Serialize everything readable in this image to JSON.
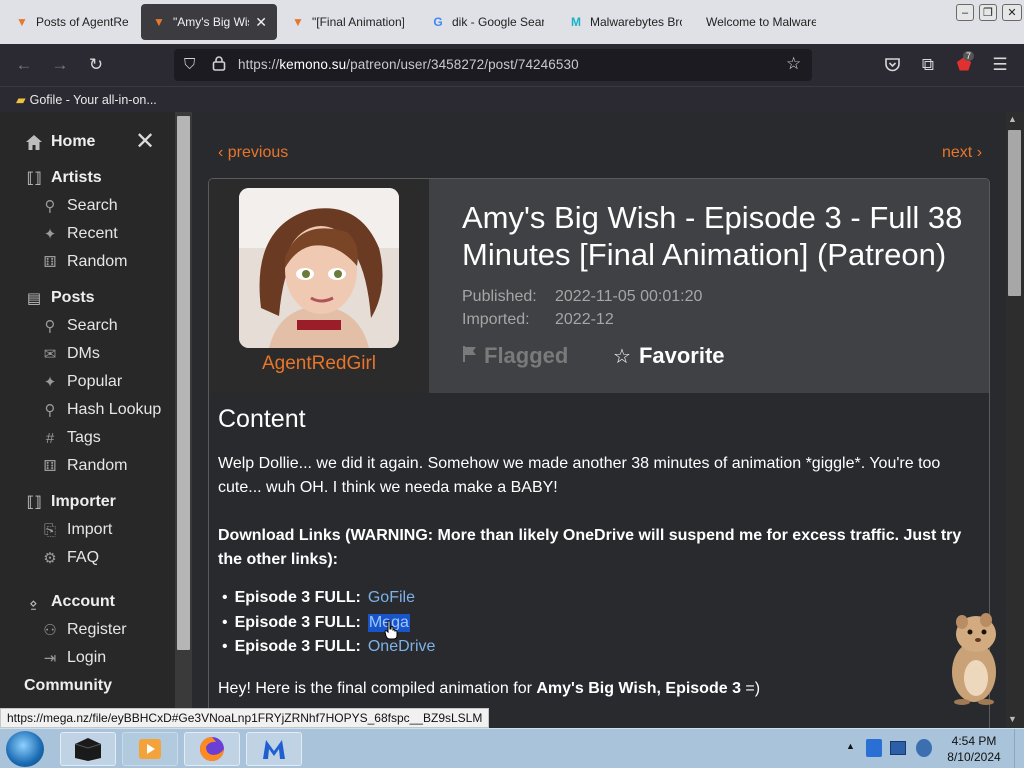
{
  "browser": {
    "tabs": [
      {
        "title": "Posts of AgentRedGirl",
        "icon": "kemono-fox-icon",
        "active": false
      },
      {
        "title": "\"Amy's Big Wish\"",
        "icon": "kemono-fox-icon",
        "active": true,
        "close": "✕"
      },
      {
        "title": "\"[Final Animation]\"",
        "icon": "kemono-fox-icon",
        "active": false
      },
      {
        "title": "dik - Google Search",
        "icon": "google-icon",
        "active": false
      },
      {
        "title": "Malwarebytes Browser Guard",
        "icon": "malwarebytes-icon",
        "active": false
      },
      {
        "title": "Welcome to Malwarebytes",
        "icon": "none",
        "active": false
      }
    ],
    "url": {
      "scheme": "https://",
      "host": "kemono.su",
      "path": "/patreon/user/3458272/post/74246530"
    },
    "extension_badge": "7",
    "bookmark": "Gofile - Your all-in-on..."
  },
  "sidebar": {
    "home": "Home",
    "sections": [
      {
        "title": "Artists",
        "items": [
          "Search",
          "Recent",
          "Random"
        ]
      },
      {
        "title": "Posts",
        "items": [
          "Search",
          "DMs",
          "Popular",
          "Hash Lookup",
          "Tags",
          "Random"
        ]
      },
      {
        "title": "Importer",
        "items": [
          "Import",
          "FAQ"
        ]
      },
      {
        "title": "Account",
        "items": [
          "Register",
          "Login"
        ]
      }
    ],
    "community": "Community"
  },
  "post": {
    "prev": "‹ previous",
    "next": "next ›",
    "artist": "AgentRedGirl",
    "title": "Amy's Big Wish - Episode 3 - Full 38 Minutes [Final Animation] (Patreon)",
    "published_label": "Published:",
    "published_value": "2022-11-05 00:01:20",
    "imported_label": "Imported:",
    "imported_value": "2022-12",
    "flag_label": "Flagged",
    "favorite_label": "Favorite",
    "content_heading": "Content",
    "intro": "Welp Dollie... we did it again. Somehow we made another 38 minutes of animation *giggle*. You're too cute... wuh OH. I think we needa make a BABY!",
    "download_heading": "Download Links (WARNING: More than likely OneDrive will suspend me for excess traffic. Just try the other links):",
    "downloads": [
      {
        "label": "Episode 3 FULL:",
        "link": "GoFile",
        "selected": false
      },
      {
        "label": "Episode 3 FULL:",
        "link": "Mega",
        "selected": true
      },
      {
        "label": "Episode 3 FULL:",
        "link": "OneDrive",
        "selected": false
      }
    ],
    "outro_prefix": "Hey! Here is the final compiled animation for ",
    "outro_bold": "Amy's Big Wish, Episode 3",
    "outro_suffix": " =)"
  },
  "status_link": "https://mega.nz/file/eyBBHCxD#Ge3VNoaLnp1FRYjZRNhf7HOPYS_68fspc__BZ9sLSLM",
  "taskbar": {
    "time": "4:54 PM",
    "date": "8/10/2024"
  },
  "colors": {
    "accent": "#e8752a",
    "link": "#7fb0e6",
    "selection": "#1a54c9"
  }
}
